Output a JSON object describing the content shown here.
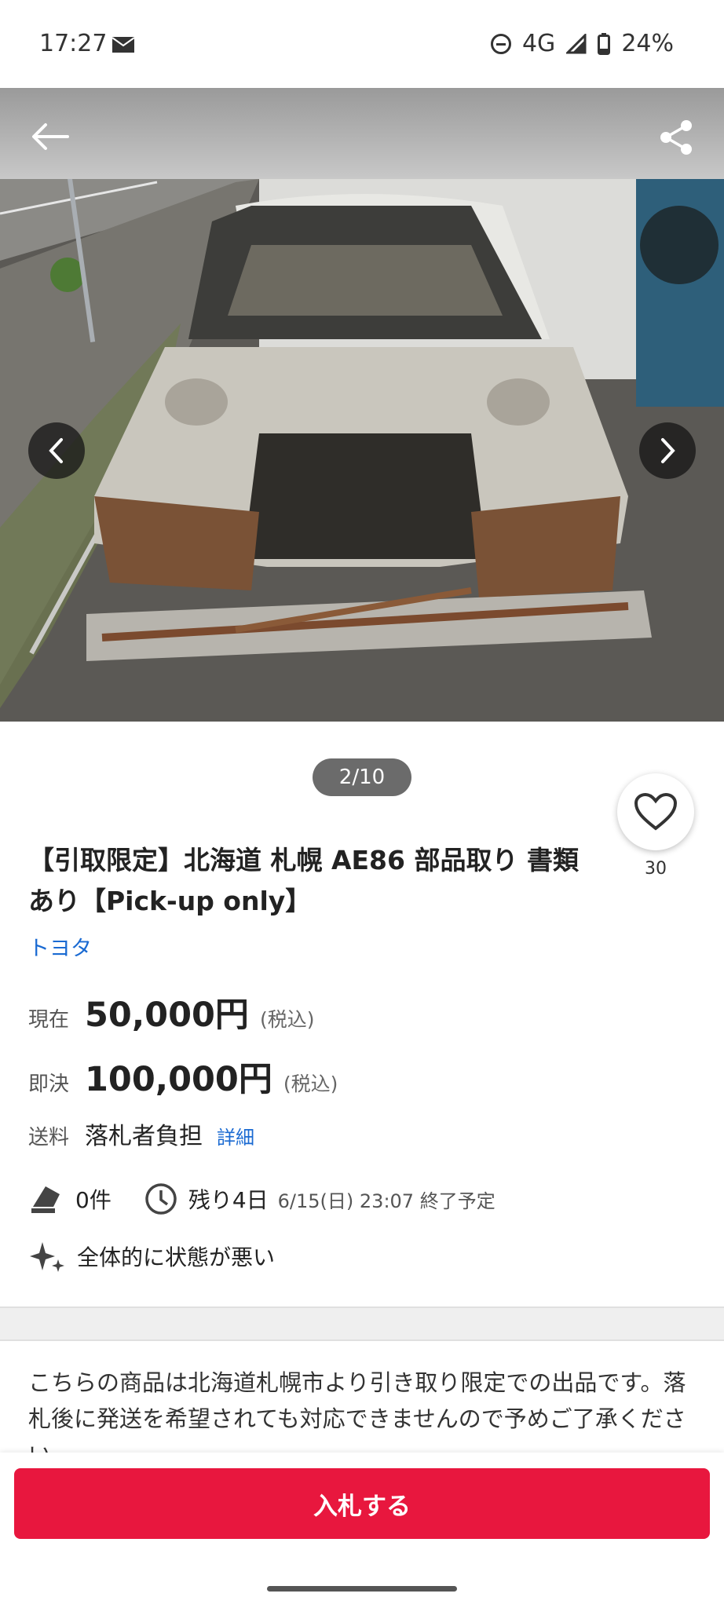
{
  "status_bar": {
    "time": "17:27",
    "network": "4G",
    "battery": "24%"
  },
  "gallery": {
    "counter": "2/10"
  },
  "favorite": {
    "count": "30"
  },
  "item": {
    "title": "【引取限定】北海道 札幌 AE86 部品取り 書類あり【Pick-up only】",
    "brand": "トヨタ"
  },
  "price": {
    "current_label": "現在",
    "current_value": "50,000円",
    "current_tax": "(税込)",
    "buyout_label": "即決",
    "buyout_value": "100,000円",
    "buyout_tax": "(税込)"
  },
  "shipping": {
    "label": "送料",
    "value": "落札者負担",
    "details_link": "詳細"
  },
  "auction": {
    "bids": "0件",
    "time_left": "残り4日",
    "end_time": "6/15(日) 23:07 終了予定",
    "condition": "全体的に状態が悪い"
  },
  "description": {
    "text": "こちらの商品は北海道札幌市より引き取り限定での出品です。落札後に発送を希望されても対応できませんので予めご了承ください。"
  },
  "actions": {
    "bid_button": "入札する"
  },
  "colors": {
    "accent": "#e8173e",
    "link": "#1a6ad2"
  },
  "icons": [
    "back-arrow-icon",
    "share-icon",
    "chevron-left-icon",
    "chevron-right-icon",
    "heart-icon",
    "gavel-icon",
    "clock-icon",
    "sparkle-icon",
    "mail-icon",
    "signal-icon",
    "battery-icon"
  ]
}
